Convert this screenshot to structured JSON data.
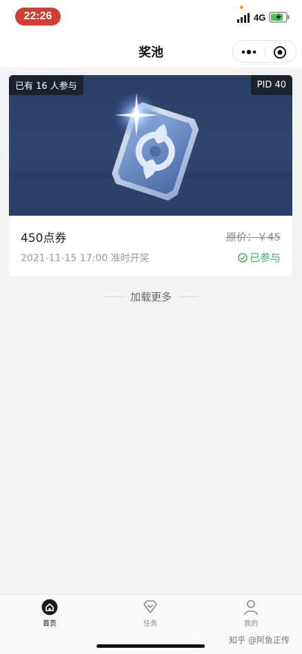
{
  "status_bar": {
    "time": "22:26",
    "network": "4G",
    "icons": [
      "signal-icon",
      "battery-charging-icon"
    ]
  },
  "nav": {
    "title": "奖池",
    "icons": [
      "more-icon",
      "close-target-icon"
    ]
  },
  "card": {
    "participants_badge": "已有 16 人参与",
    "pid_badge": "PID 40",
    "prize_name": "450点券",
    "original_price": "原价：￥45",
    "draw_time": "2021-11-15 17:00 准时开奖",
    "status": "已参与",
    "status_color": "#3cae5a",
    "banner_color": "#2f4670"
  },
  "load_more": "加载更多",
  "tabs": [
    {
      "label": "首页",
      "icon": "home-icon",
      "active": true
    },
    {
      "label": "任务",
      "icon": "diamond-icon",
      "active": false
    },
    {
      "label": "我的",
      "icon": "user-icon",
      "active": false
    }
  ],
  "watermark": "知乎 @阿鱼正传"
}
